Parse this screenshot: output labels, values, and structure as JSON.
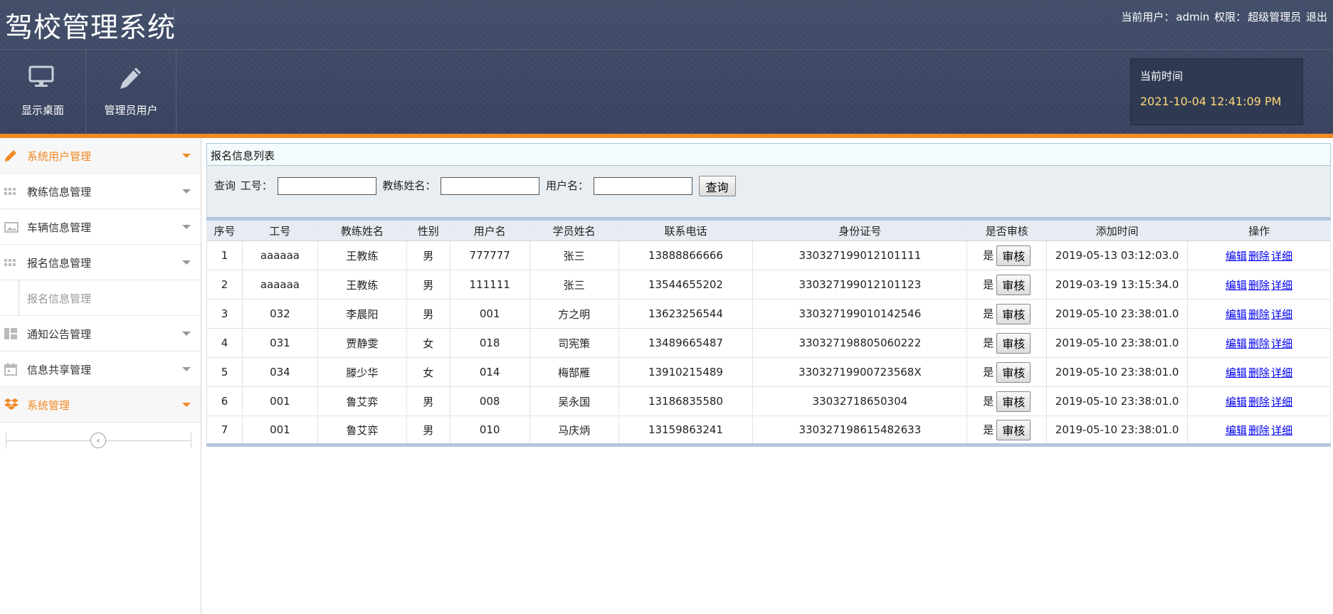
{
  "header": {
    "app_title": "驾校管理系统",
    "current_user_label": "当前用户：",
    "current_user": "admin",
    "role_label": "权限：",
    "role": "超级管理员",
    "logout": "退出"
  },
  "toolbar": {
    "desktop_label": "显示桌面",
    "desktop_icon": "monitor-icon",
    "admin_label": "管理员用户",
    "admin_icon": "pencil-icon"
  },
  "clock": {
    "label": "当前时间",
    "value": "2021-10-04 12:41:09 PM"
  },
  "sidebar": {
    "items": [
      {
        "label": "系统用户管理",
        "icon": "pencil-icon",
        "active": true
      },
      {
        "label": "教练信息管理",
        "icon": "grid-icon",
        "active": false
      },
      {
        "label": "车辆信息管理",
        "icon": "image-icon",
        "active": false
      },
      {
        "label": "报名信息管理",
        "icon": "grid-icon",
        "active": false
      },
      {
        "label": "报名信息管理",
        "icon": "sub-item",
        "active": false
      },
      {
        "label": "通知公告管理",
        "icon": "layout-icon",
        "active": false
      },
      {
        "label": "信息共享管理",
        "icon": "calendar-icon",
        "active": false
      },
      {
        "label": "系统管理",
        "icon": "dropbox-icon",
        "active": true
      }
    ]
  },
  "panel": {
    "title": "报名信息列表"
  },
  "search": {
    "query_label": "查询",
    "job_no_label": "工号：",
    "job_no_value": "",
    "coach_name_label": "教练姓名：",
    "coach_name_value": "",
    "username_label": "用户名：",
    "username_value": "",
    "button": "查询"
  },
  "table": {
    "headers": [
      "序号",
      "工号",
      "教练姓名",
      "性别",
      "用户名",
      "学员姓名",
      "联系电话",
      "身份证号",
      "是否审核",
      "添加时间",
      "操作"
    ],
    "audit_button": "审核",
    "op_edit": "编辑",
    "op_delete": "删除",
    "op_detail": "详细",
    "rows": [
      {
        "no": "1",
        "job_no": "aaaaaa",
        "coach": "王教练",
        "gender": "男",
        "username": "777777",
        "student": "张三",
        "phone": "13888866666",
        "id_card": "330327199012101111",
        "audited": "是",
        "added": "2019-05-13 03:12:03.0"
      },
      {
        "no": "2",
        "job_no": "aaaaaa",
        "coach": "王教练",
        "gender": "男",
        "username": "111111",
        "student": "张三",
        "phone": "13544655202",
        "id_card": "330327199012101123",
        "audited": "是",
        "added": "2019-03-19 13:15:34.0"
      },
      {
        "no": "3",
        "job_no": "032",
        "coach": "李晨阳",
        "gender": "男",
        "username": "001",
        "student": "方之明",
        "phone": "13623256544",
        "id_card": "330327199010142546",
        "audited": "是",
        "added": "2019-05-10 23:38:01.0"
      },
      {
        "no": "4",
        "job_no": "031",
        "coach": "贾静雯",
        "gender": "女",
        "username": "018",
        "student": "司宪策",
        "phone": "13489665487",
        "id_card": "330327198805060222",
        "audited": "是",
        "added": "2019-05-10 23:38:01.0"
      },
      {
        "no": "5",
        "job_no": "034",
        "coach": "滕少华",
        "gender": "女",
        "username": "014",
        "student": "梅郜雁",
        "phone": "13910215489",
        "id_card": "33032719900723568X",
        "audited": "是",
        "added": "2019-05-10 23:38:01.0"
      },
      {
        "no": "6",
        "job_no": "001",
        "coach": "鲁艾弈",
        "gender": "男",
        "username": "008",
        "student": "吴永国",
        "phone": "13186835580",
        "id_card": "33032718650304",
        "audited": "是",
        "added": "2019-05-10 23:38:01.0"
      },
      {
        "no": "7",
        "job_no": "001",
        "coach": "鲁艾弈",
        "gender": "男",
        "username": "010",
        "student": "马庆炳",
        "phone": "13159863241",
        "id_card": "330327198615482633",
        "audited": "是",
        "added": "2019-05-10 23:38:01.0"
      }
    ]
  },
  "colors": {
    "header_bg": "#3e4a63",
    "accent_orange": "#f08a24",
    "clock_text": "#ffd87a",
    "link_blue": "#0000ee"
  }
}
